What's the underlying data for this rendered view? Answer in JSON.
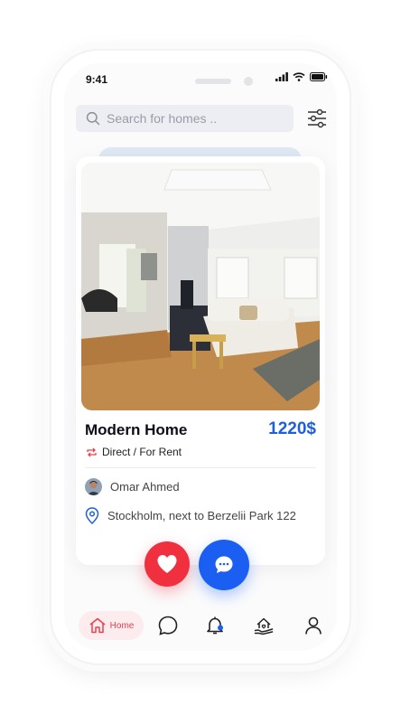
{
  "status_bar": {
    "time": "9:41"
  },
  "search": {
    "placeholder": "Search for homes .."
  },
  "listing": {
    "title": "Modern Home",
    "price": "1220$",
    "type": "Direct / For Rent",
    "owner": "Omar Ahmed",
    "location": "Stockholm, next to Berzelii Park 122"
  },
  "bottom_nav": {
    "home_label": "Home"
  },
  "colors": {
    "accent_blue": "#1d5fe0",
    "accent_red": "#f1303f"
  },
  "icons": [
    "search-icon",
    "filter-icon",
    "repeat-icon",
    "location-pin-icon",
    "heart-icon",
    "chat-icon",
    "home-icon",
    "message-icon",
    "bell-icon",
    "house-hand-icon",
    "user-icon"
  ]
}
